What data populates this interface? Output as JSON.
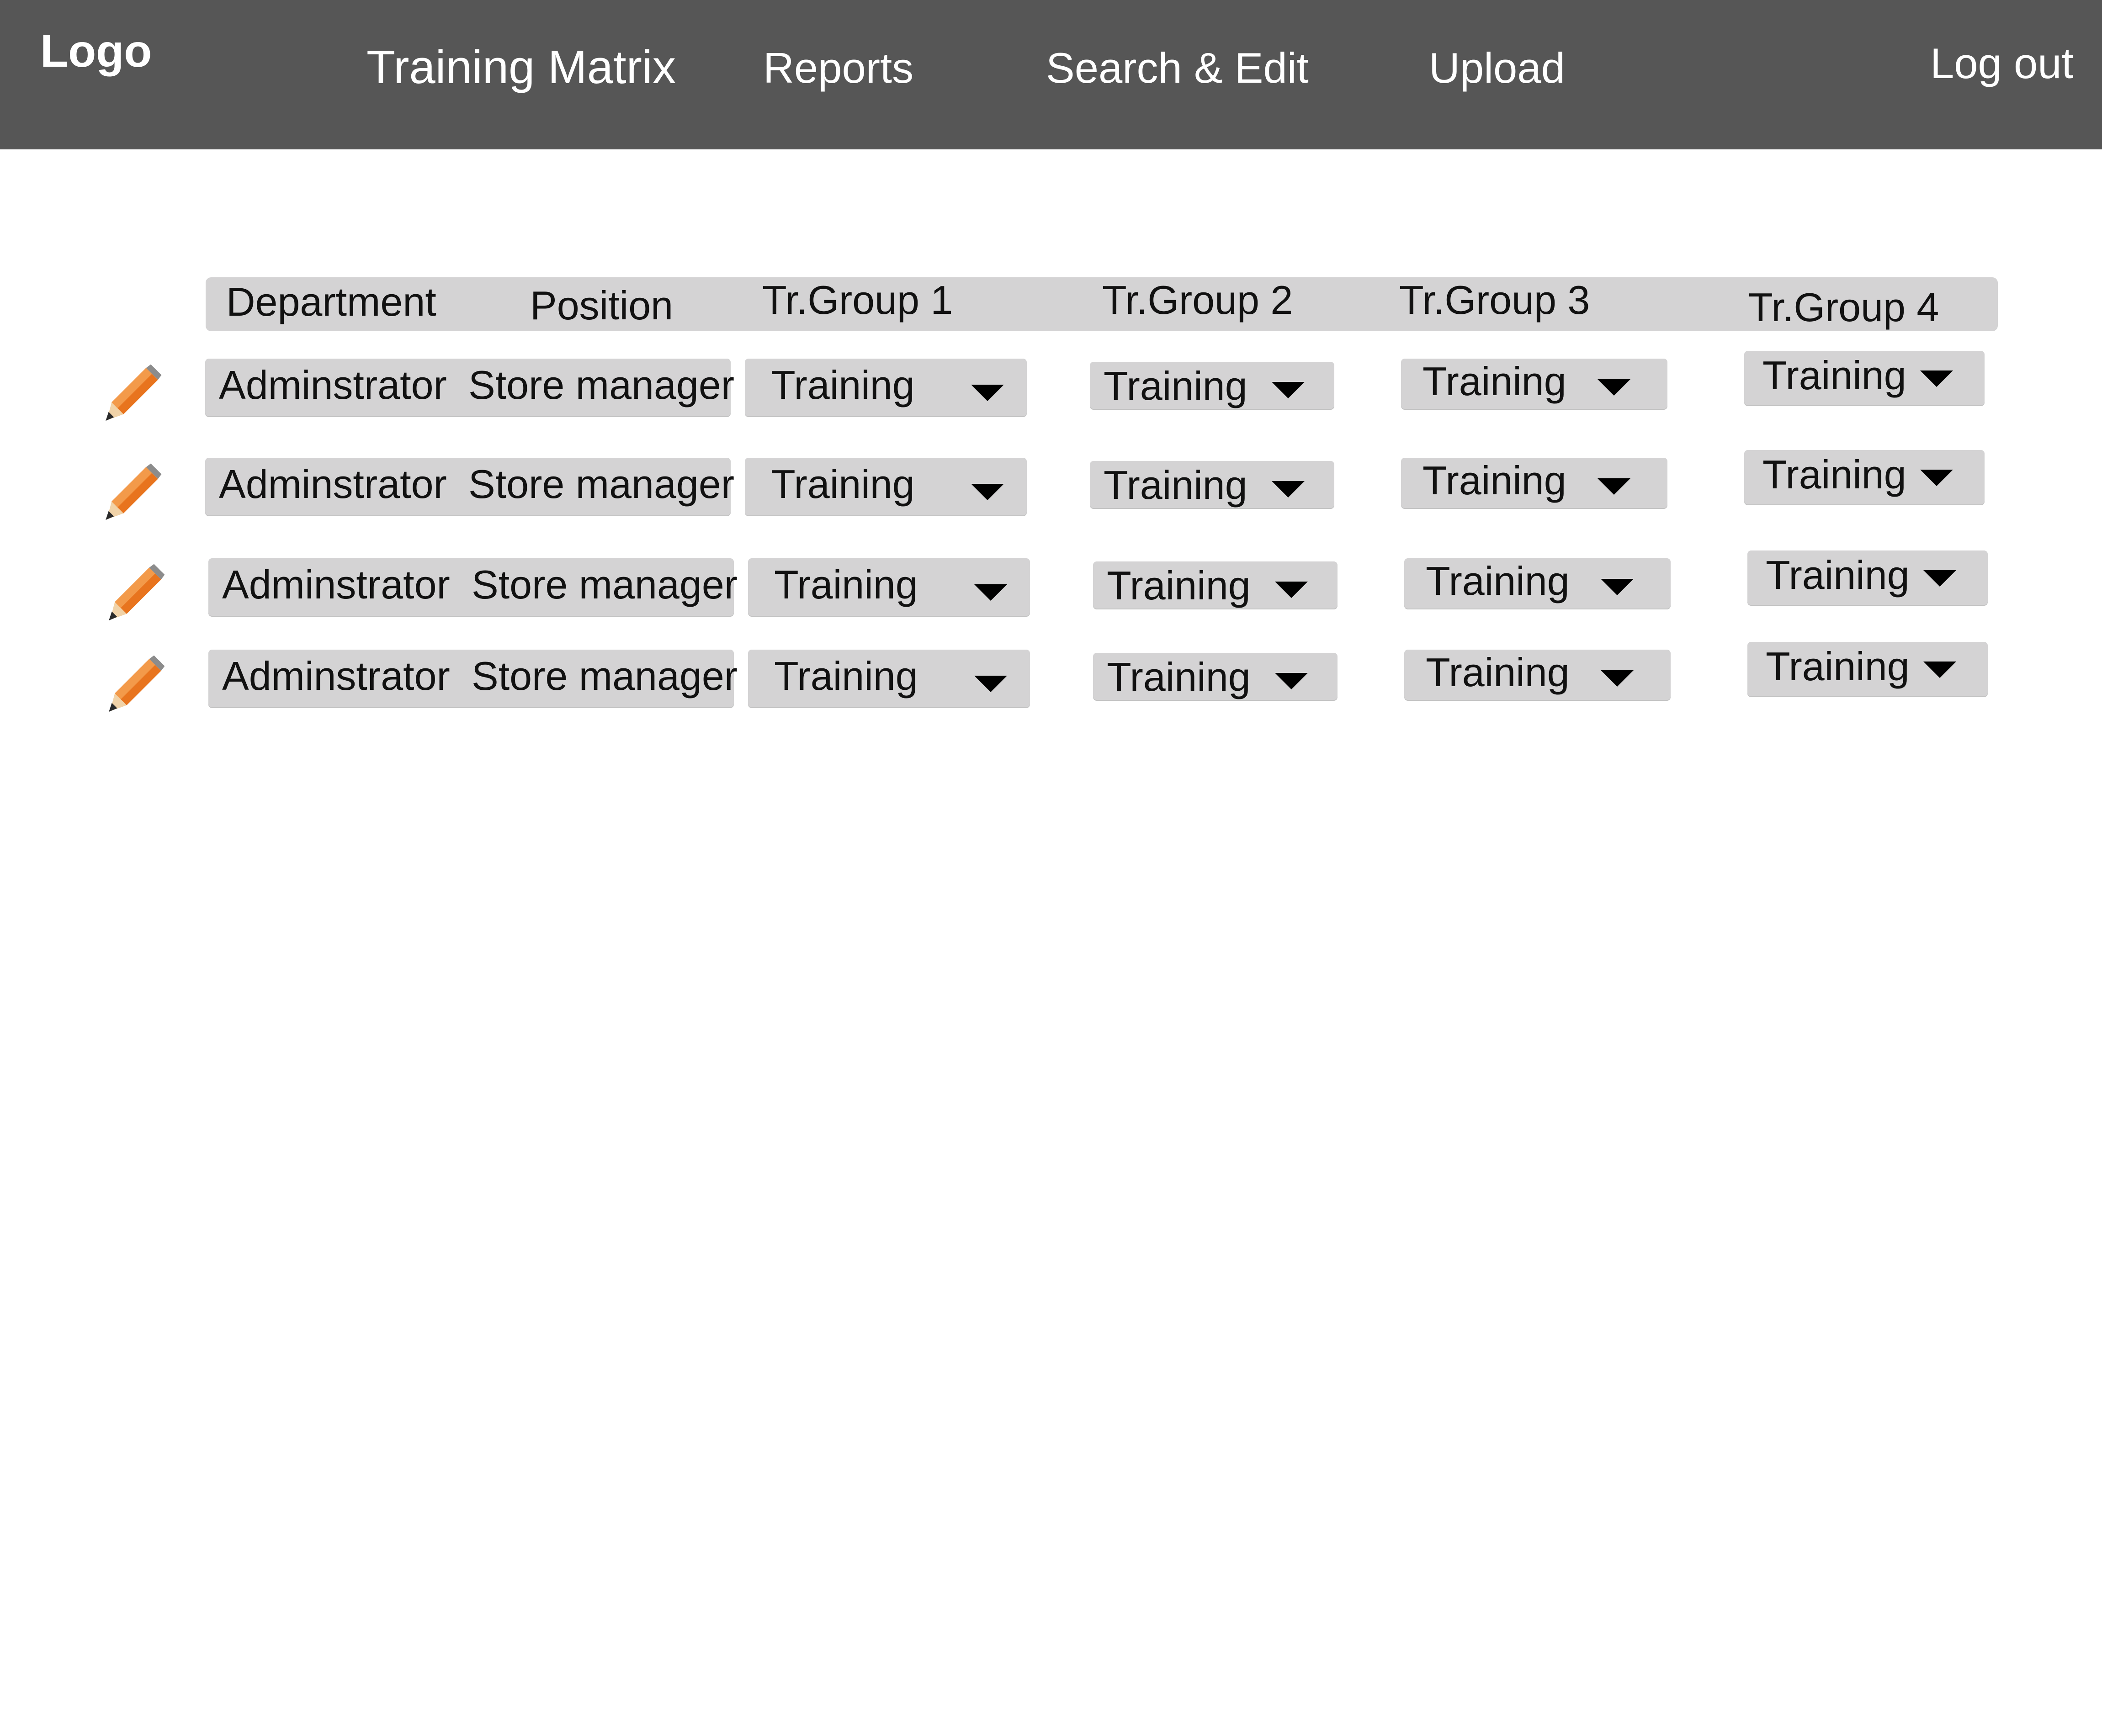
{
  "nav": {
    "logo": "Logo",
    "items": [
      "Training Matrix",
      "Reports",
      "Search & Edit",
      "Upload"
    ],
    "logout": "Log out"
  },
  "table": {
    "headers": [
      "Department",
      "Position",
      "Tr.Group 1",
      "Tr.Group 2",
      "Tr.Group 3",
      "Tr.Group 4"
    ],
    "rows": [
      {
        "department": "Adminstrator",
        "position": "Store manager",
        "groups": [
          "Training",
          "Training",
          "Training",
          "Training"
        ]
      },
      {
        "department": "Adminstrator",
        "position": "Store manager",
        "groups": [
          "Training",
          "Training",
          "Training",
          "Training"
        ]
      },
      {
        "department": "Adminstrator",
        "position": "Store manager",
        "groups": [
          "Training",
          "Training",
          "Training",
          "Training"
        ]
      },
      {
        "department": "Adminstrator",
        "position": "Store manager",
        "groups": [
          "Training",
          "Training",
          "Training",
          "Training"
        ]
      }
    ]
  },
  "colors": {
    "topbar": "#565656",
    "cell_bg": "#d4d3d4",
    "pencil": "#e8741e"
  },
  "icons": {
    "edit": "pencil-icon",
    "dropdown": "caret-down-icon"
  }
}
